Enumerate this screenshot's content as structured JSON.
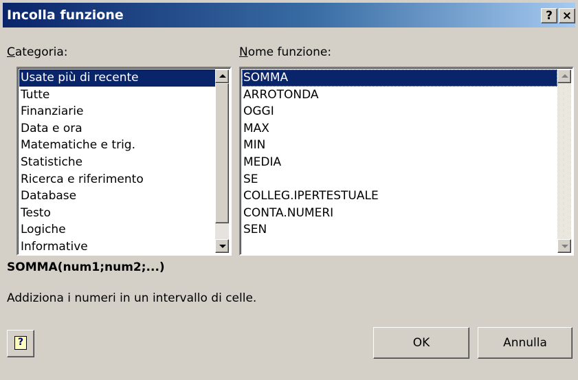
{
  "window": {
    "title": "Incolla funzione",
    "help_button": "?",
    "close_button": "×"
  },
  "categoria": {
    "label_accel": "C",
    "label_rest": "ategoria:",
    "items": [
      "Usate più di recente",
      "Tutte",
      "Finanziarie",
      "Data e ora",
      "Matematiche e trig.",
      "Statistiche",
      "Ricerca e riferimento",
      "Database",
      "Testo",
      "Logiche",
      "Informative"
    ],
    "selected": "Usate più di recente"
  },
  "nome_funzione": {
    "label_accel": "N",
    "label_rest": "ome funzione:",
    "items": [
      "SOMMA",
      "ARROTONDA",
      "OGGI",
      "MAX",
      "MIN",
      "MEDIA",
      "SE",
      "COLLEG.IPERTESTUALE",
      "CONTA.NUMERI",
      "SEN"
    ],
    "selected": "SOMMA"
  },
  "syntax": "SOMMA(num1;num2;...)",
  "description": "Addiziona i numeri in un intervallo di celle.",
  "buttons": {
    "help_glyph": "?",
    "ok": "OK",
    "cancel": "Annulla"
  },
  "colors": {
    "title_start": "#0a246a",
    "title_end": "#a6caf0",
    "face": "#d4d0c8",
    "selection": "#0a246a"
  }
}
